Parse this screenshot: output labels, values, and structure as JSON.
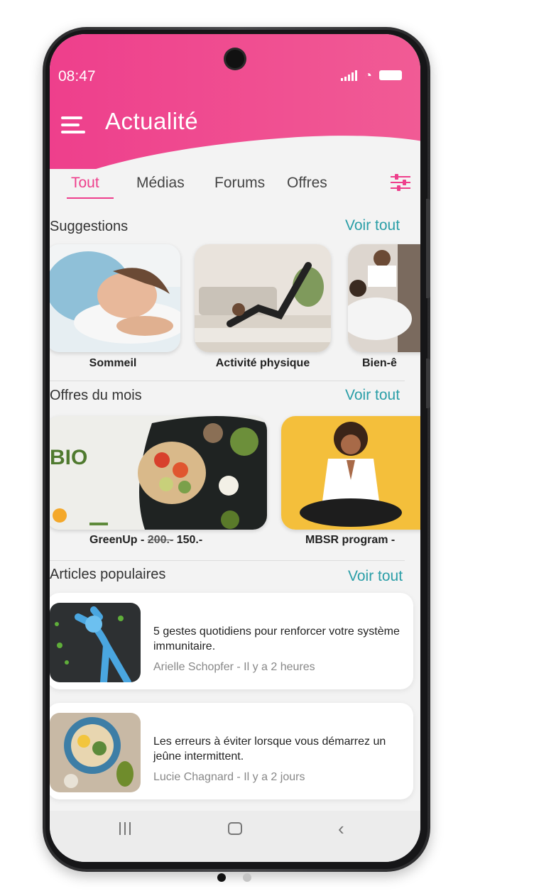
{
  "status_bar": {
    "time": "08:47"
  },
  "header": {
    "title": "Actualité"
  },
  "tabs": [
    {
      "label": "Tout",
      "active": true
    },
    {
      "label": "Médias"
    },
    {
      "label": "Forums"
    },
    {
      "label": "Offres"
    }
  ],
  "suggestions": {
    "title": "Suggestions",
    "see_all": "Voir tout",
    "items": [
      {
        "label": "Sommeil"
      },
      {
        "label": "Activité physique"
      },
      {
        "label": "Bien-ê"
      }
    ]
  },
  "offers": {
    "title": "Offres du mois",
    "see_all": "Voir tout",
    "items": [
      {
        "name": "GreenUp - ",
        "old_price": "200.-",
        "new_price": " 150.-",
        "card_text": "BIO"
      },
      {
        "name": "MBSR program -"
      }
    ]
  },
  "articles": {
    "title": "Articles populaires",
    "see_all": "Voir tout",
    "items": [
      {
        "title": "5 gestes quotidiens pour renforcer votre système immunitaire.",
        "meta": "Arielle Schopfer - Il y a 2 heures"
      },
      {
        "title": "Les erreurs à éviter lorsque vous démarrez un jeûne intermittent.",
        "meta": "Lucie Chagnard - Il y a 2 jours"
      }
    ]
  },
  "pager": {
    "count": 2,
    "active_index": 0
  },
  "colors": {
    "accent_pink": "#ee3f8c",
    "link_teal": "#2a9ea7"
  },
  "icons": [
    "menu-icon",
    "filter-icon",
    "signal-icon",
    "wifi-icon",
    "battery-icon",
    "nav-recent-icon",
    "nav-home-icon",
    "nav-back-icon"
  ]
}
